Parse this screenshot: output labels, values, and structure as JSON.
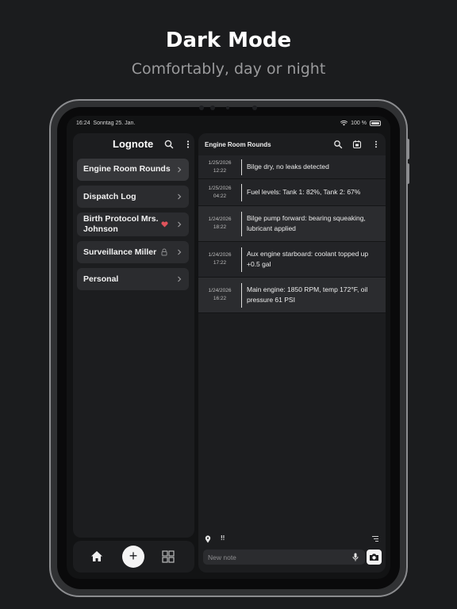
{
  "marketing": {
    "headline": "Dark Mode",
    "subline": "Comfortably, day or night"
  },
  "statusbar": {
    "time": "16:24",
    "date": "Sonntag 25. Jan.",
    "battery": "100 %"
  },
  "app": {
    "title": "Lognote"
  },
  "notebooks": [
    {
      "label": "Engine Room Rounds",
      "selected": true,
      "badge": ""
    },
    {
      "label": "Dispatch Log",
      "selected": false,
      "badge": ""
    },
    {
      "label": "Birth Protocol Mrs. Johnson",
      "selected": false,
      "badge": "heart-icon"
    },
    {
      "label": "Surveillance Miller",
      "selected": false,
      "badge": "lock-icon"
    },
    {
      "label": "Personal",
      "selected": false,
      "badge": ""
    }
  ],
  "log": {
    "title": "Engine Room Rounds",
    "entries": [
      {
        "date": "1/25/2026",
        "time": "12:22",
        "text": "Bilge dry, no leaks detected"
      },
      {
        "date": "1/25/2026",
        "time": "04:22",
        "text": "Fuel levels: Tank 1: 82%, Tank 2: 67%"
      },
      {
        "date": "1/24/2026",
        "time": "18:22",
        "text": "Bilge pump forward: bearing squeaking, lubricant applied"
      },
      {
        "date": "1/24/2026",
        "time": "17:22",
        "text": "Aux engine starboard: coolant topped up +0.5 gal"
      },
      {
        "date": "1/24/2026",
        "time": "16:22",
        "text": "Main engine: 1850 RPM, temp 172°F, oil pressure 61 PSI"
      }
    ]
  },
  "composer": {
    "placeholder": "New note",
    "value": "",
    "important_marker": "!!"
  },
  "colors": {
    "background": "#1b1c1e",
    "pane": "#1c1d1f",
    "item": "#2b2c2f",
    "heart": "#e0535b"
  }
}
